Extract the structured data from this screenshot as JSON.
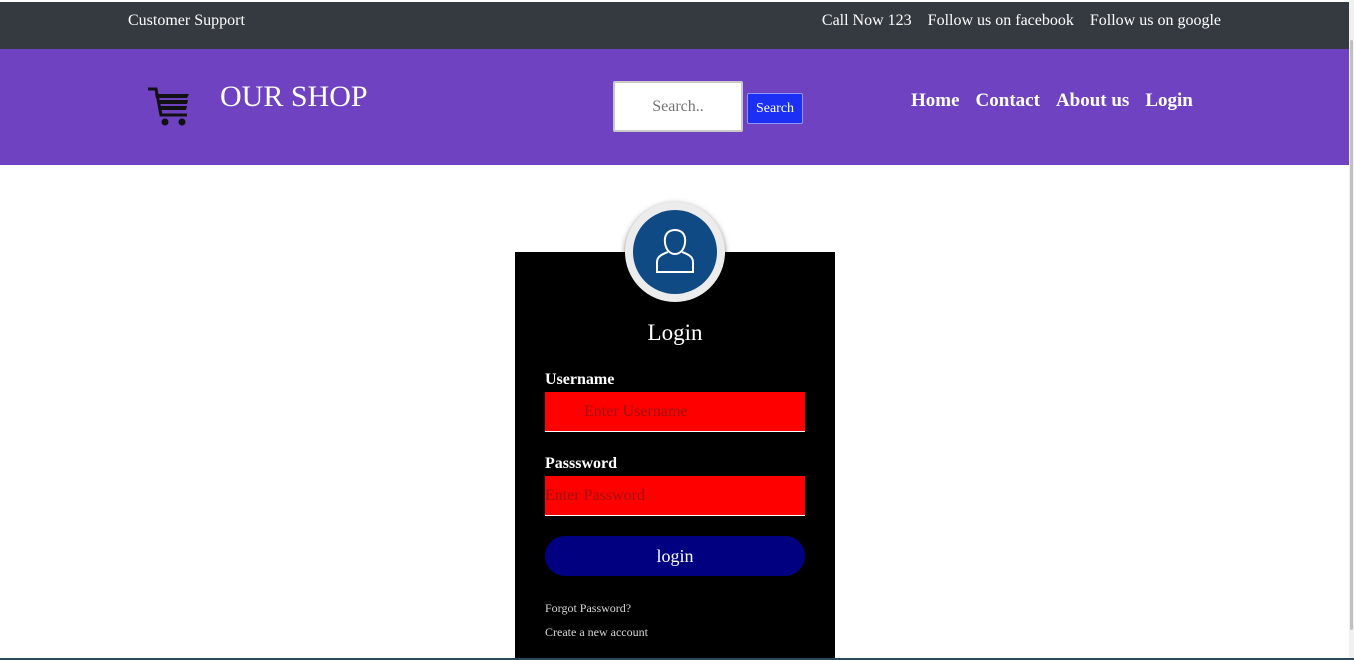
{
  "topbar": {
    "support": "Customer Support",
    "call": "Call Now 123",
    "facebook": "Follow us on facebook",
    "google": "Follow us on google",
    "bg_color": "#343a40"
  },
  "header": {
    "brand": "OUR SHOP",
    "cart_icon": "shopping-cart-icon",
    "bg_color": "#6f42c1",
    "search": {
      "placeholder": "Search..",
      "value": "",
      "button_label": "Search"
    },
    "nav": {
      "home": "Home",
      "contact": "Contact",
      "about": "About us",
      "login": "Login"
    }
  },
  "login_card": {
    "avatar_icon": "user-icon",
    "title": "Login",
    "username_label": "Username",
    "username_placeholder": "Enter Username",
    "password_label": "Passsword",
    "password_placeholder": "Enter Password",
    "submit_label": "login",
    "forgot_link": "Forgot Password?",
    "create_link": "Create a new account",
    "field_color": "#ff0000",
    "button_color": "#000080"
  }
}
